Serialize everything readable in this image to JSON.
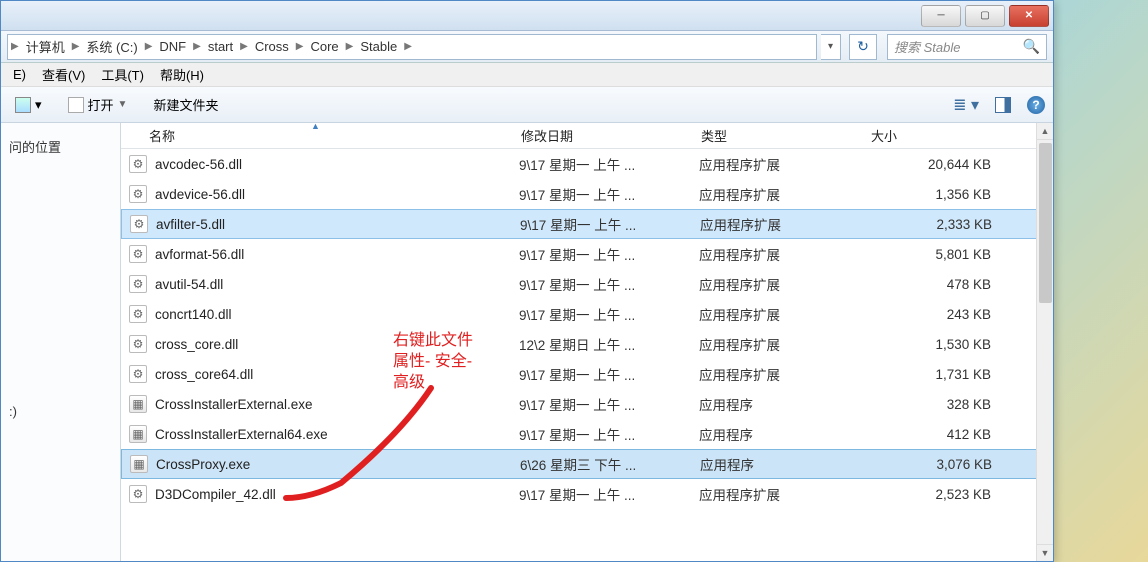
{
  "window": {
    "min": "─",
    "max": "▢",
    "close": "✕"
  },
  "breadcrumb": {
    "items": [
      "计算机",
      "系统 (C:)",
      "DNF",
      "start",
      "Cross",
      "Core",
      "Stable"
    ],
    "sep": "▶"
  },
  "search": {
    "placeholder": "搜索 Stable"
  },
  "menubar": {
    "items": [
      "E)",
      "查看(V)",
      "工具(T)",
      "帮助(H)"
    ]
  },
  "toolbar": {
    "open": "打开",
    "newfolder": "新建文件夹"
  },
  "sidebar": {
    "recent": "问的位置",
    "lib": ":)"
  },
  "columns": {
    "name": "名称",
    "date": "修改日期",
    "type": "类型",
    "size": "大小"
  },
  "files": [
    {
      "icon": "dll",
      "name": "avcodec-56.dll",
      "date": "9\\17 星期一 上午 ...",
      "type": "应用程序扩展",
      "size": "20,644 KB",
      "sel": false
    },
    {
      "icon": "dll",
      "name": "avdevice-56.dll",
      "date": "9\\17 星期一 上午 ...",
      "type": "应用程序扩展",
      "size": "1,356 KB",
      "sel": false
    },
    {
      "icon": "dll",
      "name": "avfilter-5.dll",
      "date": "9\\17 星期一 上午 ...",
      "type": "应用程序扩展",
      "size": "2,333 KB",
      "sel": true
    },
    {
      "icon": "dll",
      "name": "avformat-56.dll",
      "date": "9\\17 星期一 上午 ...",
      "type": "应用程序扩展",
      "size": "5,801 KB",
      "sel": false
    },
    {
      "icon": "dll",
      "name": "avutil-54.dll",
      "date": "9\\17 星期一 上午 ...",
      "type": "应用程序扩展",
      "size": "478 KB",
      "sel": false
    },
    {
      "icon": "dll",
      "name": "concrt140.dll",
      "date": "9\\17 星期一 上午 ...",
      "type": "应用程序扩展",
      "size": "243 KB",
      "sel": false
    },
    {
      "icon": "dll",
      "name": "cross_core.dll",
      "date": "12\\2 星期日 上午 ...",
      "type": "应用程序扩展",
      "size": "1,530 KB",
      "sel": false
    },
    {
      "icon": "dll",
      "name": "cross_core64.dll",
      "date": "9\\17 星期一 上午 ...",
      "type": "应用程序扩展",
      "size": "1,731 KB",
      "sel": false
    },
    {
      "icon": "exe",
      "name": "CrossInstallerExternal.exe",
      "date": "9\\17 星期一 上午 ...",
      "type": "应用程序",
      "size": "328 KB",
      "sel": false
    },
    {
      "icon": "exe",
      "name": "CrossInstallerExternal64.exe",
      "date": "9\\17 星期一 上午 ...",
      "type": "应用程序",
      "size": "412 KB",
      "sel": false
    },
    {
      "icon": "exe",
      "name": "CrossProxy.exe",
      "date": "6\\26 星期三 下午 ...",
      "type": "应用程序",
      "size": "3,076 KB",
      "sel": "strong"
    },
    {
      "icon": "dll",
      "name": "D3DCompiler_42.dll",
      "date": "9\\17 星期一 上午 ...",
      "type": "应用程序扩展",
      "size": "2,523 KB",
      "sel": false
    }
  ],
  "annotation": {
    "line1": "右键此文件",
    "line2": "属性-  安全-",
    "line3": "高级"
  }
}
